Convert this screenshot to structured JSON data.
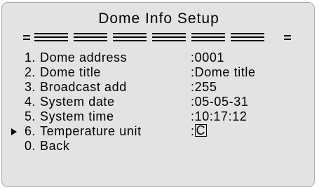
{
  "menu": {
    "title": "Dome Info Setup",
    "items": [
      {
        "number": "1.",
        "label": "Dome address",
        "value": ":0001",
        "selected": false
      },
      {
        "number": "2.",
        "label": "Dome title",
        "value": ":Dome title",
        "selected": false
      },
      {
        "number": "3.",
        "label": "Broadcast add",
        "value": ":255",
        "selected": false
      },
      {
        "number": "4.",
        "label": "System date",
        "value": ":05-05-31",
        "selected": false
      },
      {
        "number": "5.",
        "label": "System time",
        "value": ":10:17:12",
        "selected": false
      },
      {
        "number": "6.",
        "label": "Temperature unit",
        "value_prefix": ":",
        "value_cursor": "C",
        "selected": true
      },
      {
        "number": "0.",
        "label": "Back",
        "value": "",
        "selected": false
      }
    ],
    "selection_indicator_icon": "triangle-right-icon"
  },
  "colors": {
    "screen_background": "#e3e3e3",
    "screen_border": "#a9a9a9",
    "text": "#000000"
  }
}
